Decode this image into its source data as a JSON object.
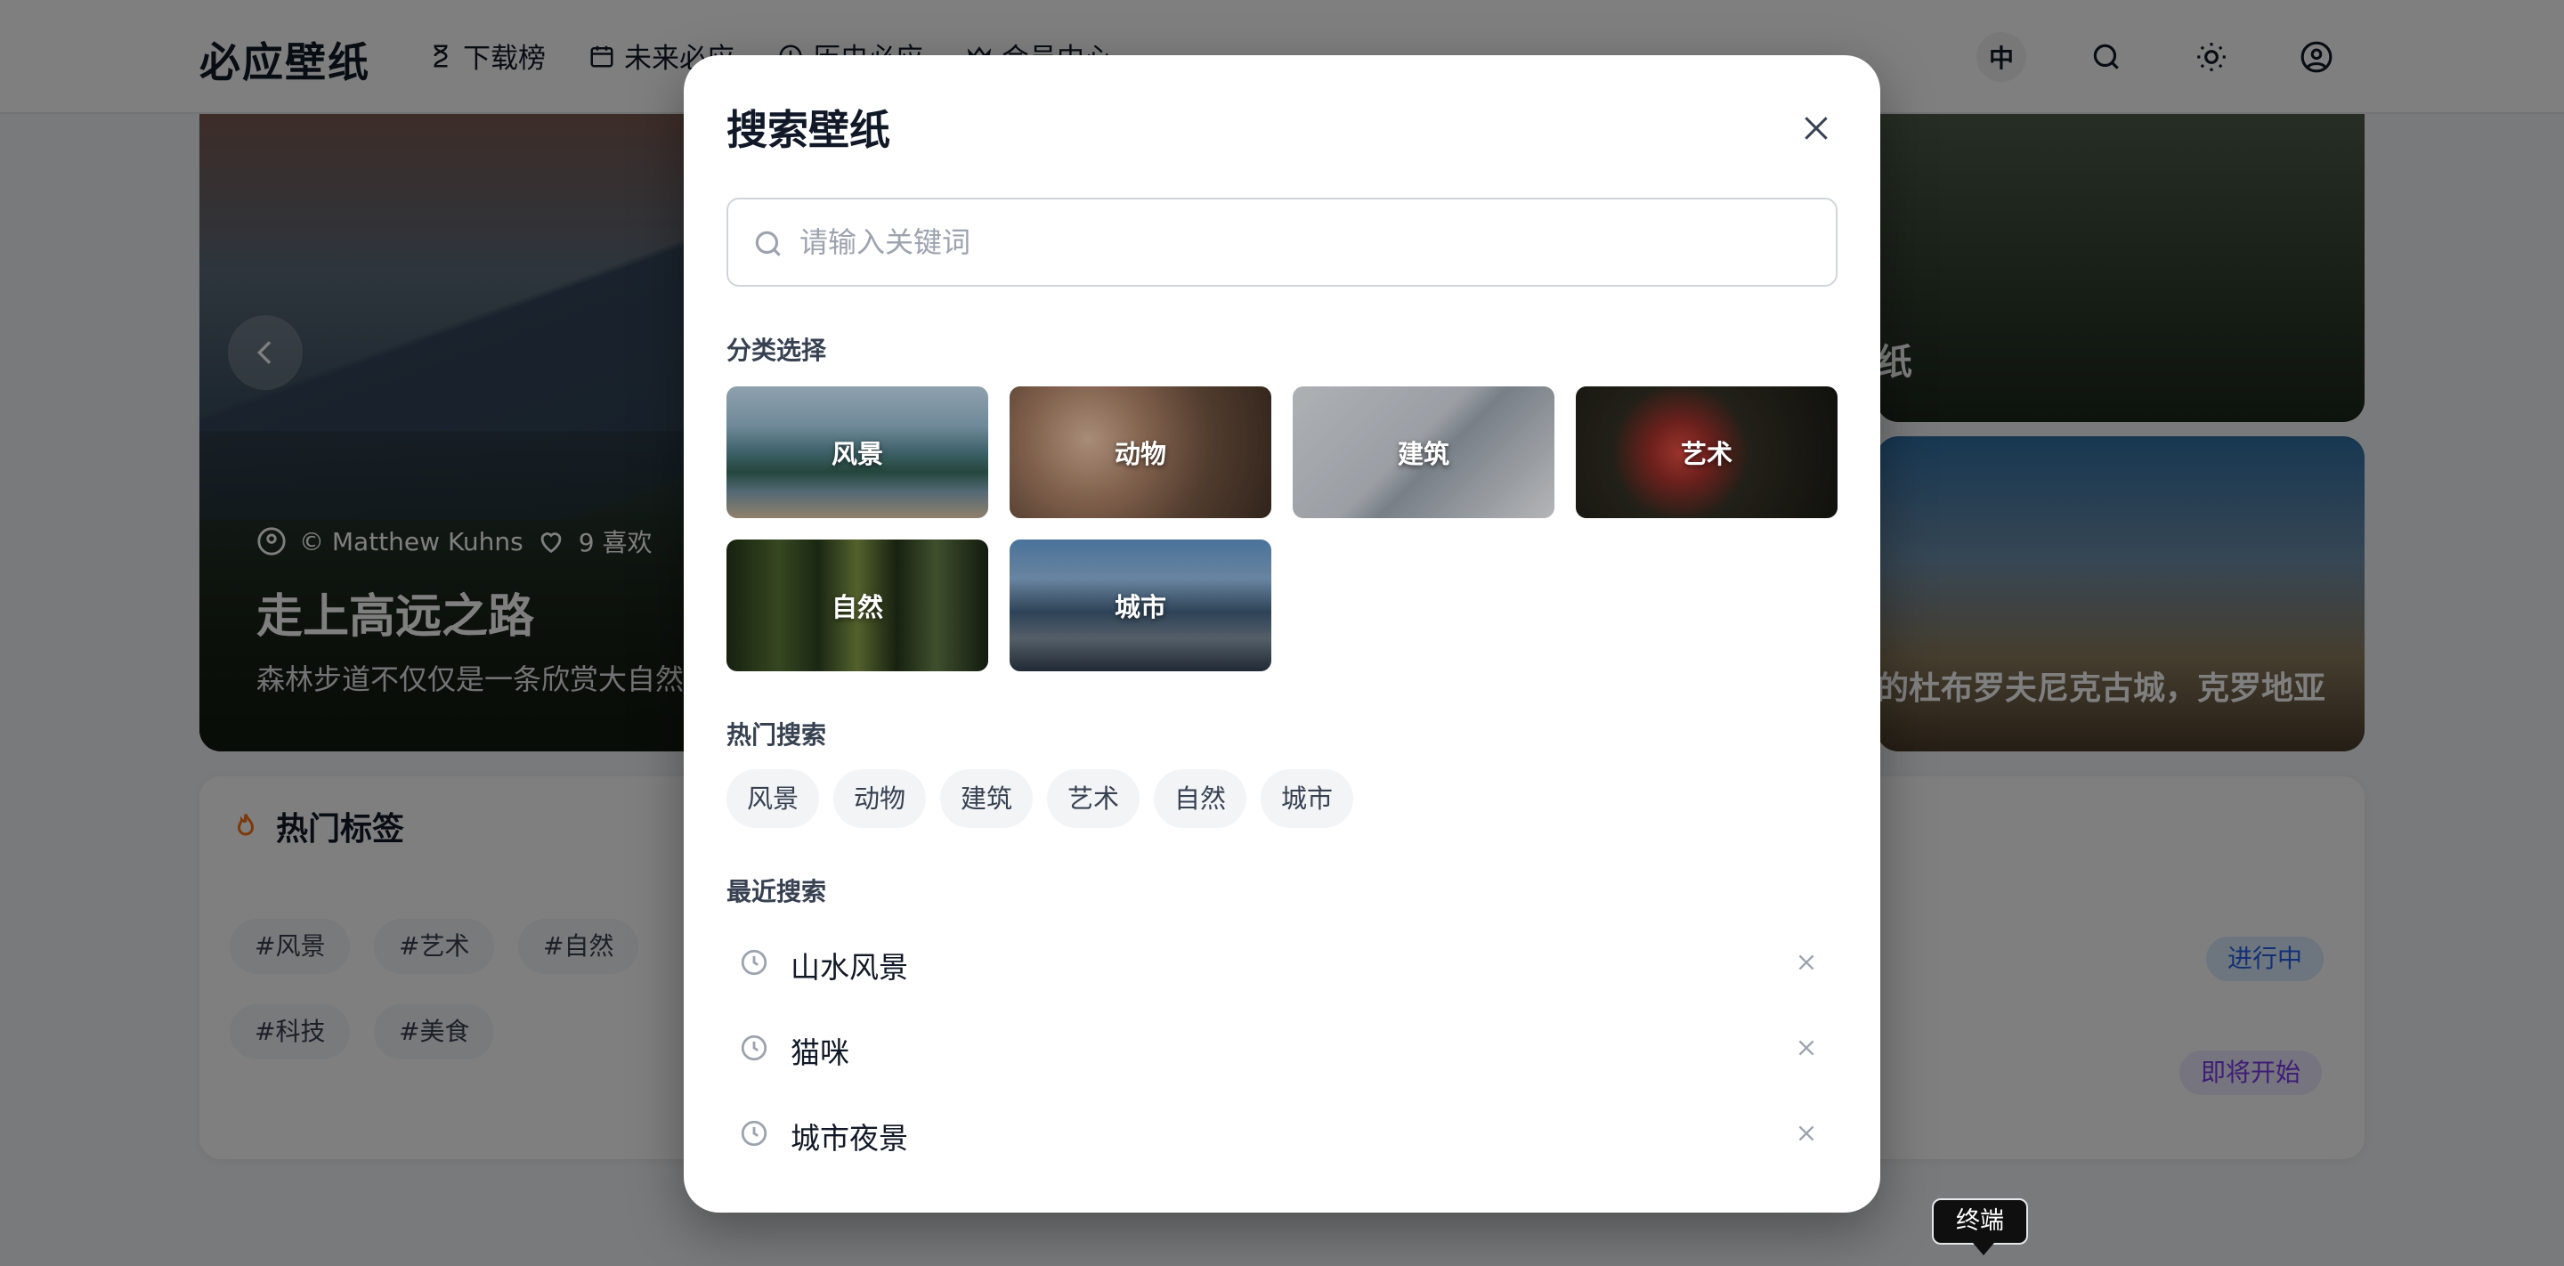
{
  "app": {
    "logo": "必应壁纸",
    "nav": [
      {
        "label": "下载榜",
        "icon": "hourglass-icon"
      },
      {
        "label": "未来必应",
        "icon": "calendar-icon"
      },
      {
        "label": "历史必应",
        "icon": "history-icon"
      },
      {
        "label": "会员中心",
        "icon": "crown-icon"
      }
    ],
    "lang_label": "中"
  },
  "hero": {
    "author": "© Matthew Kuhns",
    "likes": "9 喜欢",
    "title": "走上高远之路",
    "description": "森林步道不仅仅是一条欣赏大自然",
    "right_top_text": "纸",
    "right_bottom_text": "的杜布罗夫尼克古城，克罗地亚"
  },
  "tags": {
    "title": "热门标签",
    "items": [
      "#风景",
      "#艺术",
      "#自然",
      "#科技",
      "#美食"
    ],
    "status_ongoing": "进行中",
    "status_upcoming": "即将开始"
  },
  "modal": {
    "title": "搜索壁纸",
    "search_placeholder": "请输入关键词",
    "categories_label": "分类选择",
    "categories": [
      {
        "label": "风景",
        "tone": "landscape"
      },
      {
        "label": "动物",
        "tone": "animal"
      },
      {
        "label": "建筑",
        "tone": "architecture"
      },
      {
        "label": "艺术",
        "tone": "art"
      },
      {
        "label": "自然",
        "tone": "nature"
      },
      {
        "label": "城市",
        "tone": "city"
      }
    ],
    "hot_label": "热门搜索",
    "hot_searches": [
      "风景",
      "动物",
      "建筑",
      "艺术",
      "自然",
      "城市"
    ],
    "recent_label": "最近搜索",
    "recent_searches": [
      "山水风景",
      "猫咪",
      "城市夜景"
    ]
  },
  "tooltip": {
    "text": "终端"
  },
  "colors": {
    "overlay": "#00000080",
    "accent_blue": "#2563eb",
    "accent_purple": "#7c3aed"
  }
}
